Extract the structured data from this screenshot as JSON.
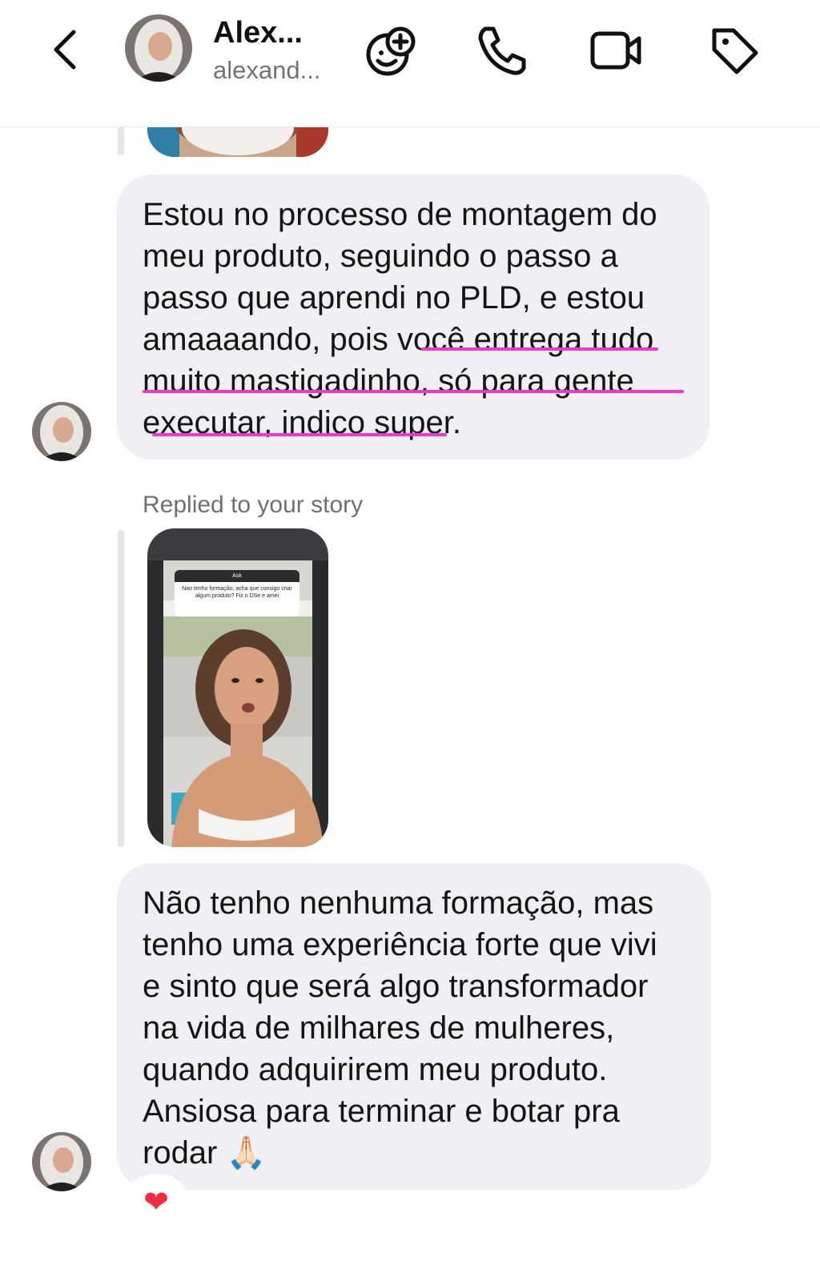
{
  "header": {
    "name": "Alex...",
    "username": "alexand...",
    "icons": [
      "chevron-left-icon",
      "effects-icon",
      "phone-icon",
      "video-icon",
      "tag-icon"
    ]
  },
  "messages": [
    {
      "lines": [
        "Estou no processo de montagem do",
        "meu produto, seguindo o passo a",
        "passo que aprendi no PLD, e estou",
        "amaaaando, pois você entrega tudo",
        "muito mastigadinho, só para gente",
        "executar, indico super."
      ]
    },
    {
      "lines": [
        "Não tenho nenhuma formação, mas",
        "tenho uma experiência forte que vivi",
        "e sinto que será algo transformador",
        "na vida de milhares de mulheres,",
        "quando adquirirem meu produto.",
        "Ansiosa para terminar e botar pra",
        "rodar 🙏🏻"
      ],
      "reaction": "❤"
    }
  ],
  "story_reply": {
    "label": "Replied to your story",
    "story_question_title": "Ask",
    "story_question": "Nao tenho formação, acha que consigo criar algum produto? Fiz o DSe e amei"
  },
  "colors": {
    "bubble": "#efeff4",
    "highlight": "#e63ad1",
    "secondary_text": "#737378"
  }
}
